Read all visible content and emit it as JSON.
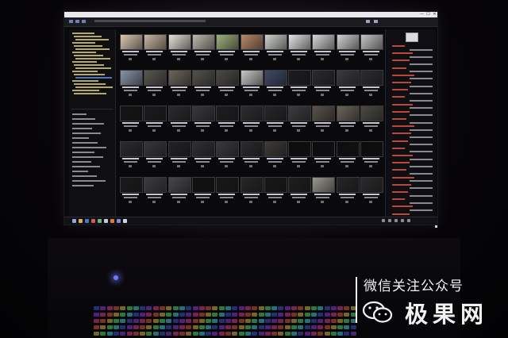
{
  "watermark": {
    "line1": "微信关注公众号",
    "line2": "极果网",
    "logo": "wechat-logo-icon"
  },
  "screen": {
    "app": "photo-browser",
    "title_bar_buttons": [
      "—",
      "☐",
      "✕"
    ],
    "grid_rows": 6,
    "grid_cols": 11
  },
  "colors": {
    "accent_blue": "#4f74c9",
    "folder_yellow": "#b5a96a",
    "metadata_red": "#d6533f",
    "power_led": "#6f7bff"
  }
}
